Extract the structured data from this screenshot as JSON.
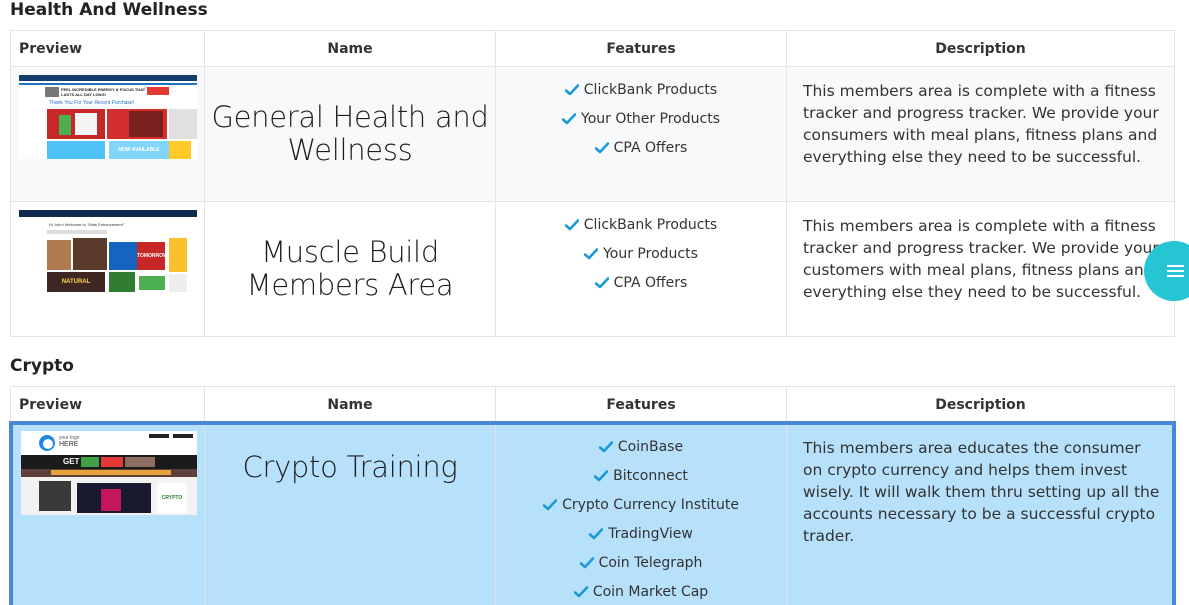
{
  "sections": [
    {
      "title": "Health And Wellness",
      "headers": {
        "preview": "Preview",
        "name": "Name",
        "features": "Features",
        "description": "Description"
      },
      "rows": [
        {
          "name_line1": "General Health and",
          "name_line2": "Wellness",
          "features": [
            "ClickBank Products",
            "Your Other Products",
            "CPA Offers"
          ],
          "description": "This members area is complete with a fitness tracker and progress tracker. We provide your consumers with meal plans, fitness plans and everything else they need to be successful.",
          "thumb_text": [
            "FEEL INCREDIBLE ENERGY & FOCUS THAT LASTS ALL DAY LONG!",
            "Thank You For Your Recent Purchase!",
            "NOW AVAILABLE"
          ]
        },
        {
          "name_line1": "Muscle Build",
          "name_line2": "Members Area",
          "features": [
            "ClickBank Products",
            "Your Products",
            "CPA Offers"
          ],
          "description": "This members area is complete with a fitness tracker and progress tracker. We provide your customers with meal plans, fitness plans and everything else they need to be successful.",
          "thumb_text": [
            "Hi John! Welcome to \"Male Enhancement\"",
            "TOMORROW",
            "NATURAL"
          ]
        }
      ]
    },
    {
      "title": "Crypto",
      "headers": {
        "preview": "Preview",
        "name": "Name",
        "features": "Features",
        "description": "Description"
      },
      "rows": [
        {
          "name_line1": "Crypto Training",
          "features": [
            "CoinBase",
            "Bitconnect",
            "Crypto Currency Institute",
            "TradingView",
            "Coin Telegraph",
            "Coin Market Cap"
          ],
          "description": "This members area educates the consumer on crypto currency and helps them invest wisely. It will walk them thru setting up all the accounts necessary to be a successful crypto trader.",
          "thumb_text": [
            "your logo",
            "HERE",
            "GET",
            "CRYPTO"
          ]
        }
      ]
    }
  ],
  "colors": {
    "check": "#1a9ad6",
    "highlight": "#b7e0fb",
    "highlight_border": "#4a86d8",
    "fab": "#25c5d4"
  },
  "fab": {
    "icon": "menu-icon"
  }
}
